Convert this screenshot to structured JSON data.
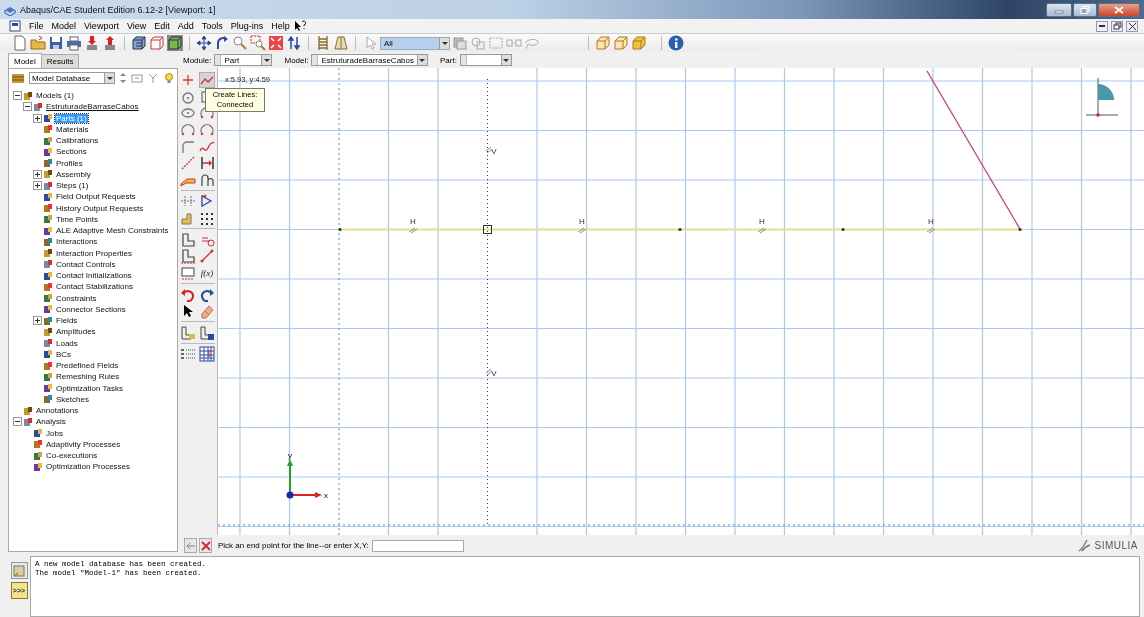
{
  "window": {
    "title": "Abaqus/CAE Student Edition 6.12-2 [Viewport: 1]"
  },
  "menu": [
    "File",
    "Model",
    "Viewport",
    "View",
    "Edit",
    "Add",
    "Tools",
    "Plug-ins",
    "Help"
  ],
  "toolbar": {
    "selection_filter": "All"
  },
  "tabs": [
    {
      "label": "Model",
      "selected": true
    },
    {
      "label": "Results",
      "selected": false
    }
  ],
  "context_bar": [
    {
      "label": "Module:",
      "value": "Part"
    },
    {
      "label": "Model:",
      "value": "EstruturadeBarraseCabos"
    },
    {
      "label": "Part:"
    }
  ],
  "model_tree": {
    "source": "Model Database",
    "items": [
      {
        "label": "Models (1)",
        "selected": false,
        "expanded": true,
        "children": [
          {
            "label": "EstruturadeBarraseCabos",
            "selected": false,
            "current": true,
            "expanded": true,
            "children": [
              {
                "label": "Parts (1)",
                "selected": true,
                "expanded": false
              },
              {
                "label": "Materials",
                "selected": false
              },
              {
                "label": "Calibrations",
                "selected": false
              },
              {
                "label": "Sections",
                "selected": false
              },
              {
                "label": "Profiles",
                "selected": false
              },
              {
                "label": "Assembly",
                "selected": false,
                "expanded": false
              },
              {
                "label": "Steps (1)",
                "selected": false,
                "expanded": false
              },
              {
                "label": "Field Output Requests",
                "selected": false
              },
              {
                "label": "History Output Requests",
                "selected": false
              },
              {
                "label": "Time Points",
                "selected": false
              },
              {
                "label": "ALE Adaptive Mesh Constraints",
                "selected": false
              },
              {
                "label": "Interactions",
                "selected": false
              },
              {
                "label": "Interaction Properties",
                "selected": false
              },
              {
                "label": "Contact Controls",
                "selected": false
              },
              {
                "label": "Contact Initializations",
                "selected": false
              },
              {
                "label": "Contact Stabilizations",
                "selected": false
              },
              {
                "label": "Constraints",
                "selected": false
              },
              {
                "label": "Connector Sections",
                "selected": false
              },
              {
                "label": "Fields",
                "selected": false,
                "expanded": false
              },
              {
                "label": "Amplitudes",
                "selected": false
              },
              {
                "label": "Loads",
                "selected": false
              },
              {
                "label": "BCs",
                "selected": false
              },
              {
                "label": "Predefined Fields",
                "selected": false
              },
              {
                "label": "Remeshing Rules",
                "selected": false
              },
              {
                "label": "Optimization Tasks",
                "selected": false
              },
              {
                "label": "Sketches",
                "selected": false
              }
            ]
          }
        ]
      },
      {
        "label": "Annotations",
        "selected": false
      },
      {
        "label": "Analysis",
        "selected": false,
        "expanded": true,
        "children": [
          {
            "label": "Jobs",
            "selected": false
          },
          {
            "label": "Adaptivity Processes",
            "selected": false
          },
          {
            "label": "Co-executions",
            "selected": false
          },
          {
            "label": "Optimization Processes",
            "selected": false
          }
        ]
      }
    ]
  },
  "sketch_toolbox": {
    "function_button": "f(x)",
    "tooltip": "Create Lines: Connected"
  },
  "viewport": {
    "cursor_position": "x:5.93, y:4.59",
    "constraint_marks": [
      "H",
      "H",
      "H",
      "H",
      "V",
      "V"
    ],
    "axis_labels": [
      "y",
      "x"
    ]
  },
  "prompt": {
    "text": "Pick an end point for the line--or enter X,Y:"
  },
  "brand": "SIMULIA",
  "message_area": {
    "command_tab": ">>>",
    "messages": [
      "A new model database has been created.",
      "The model \"Model-1\" has been created."
    ]
  }
}
